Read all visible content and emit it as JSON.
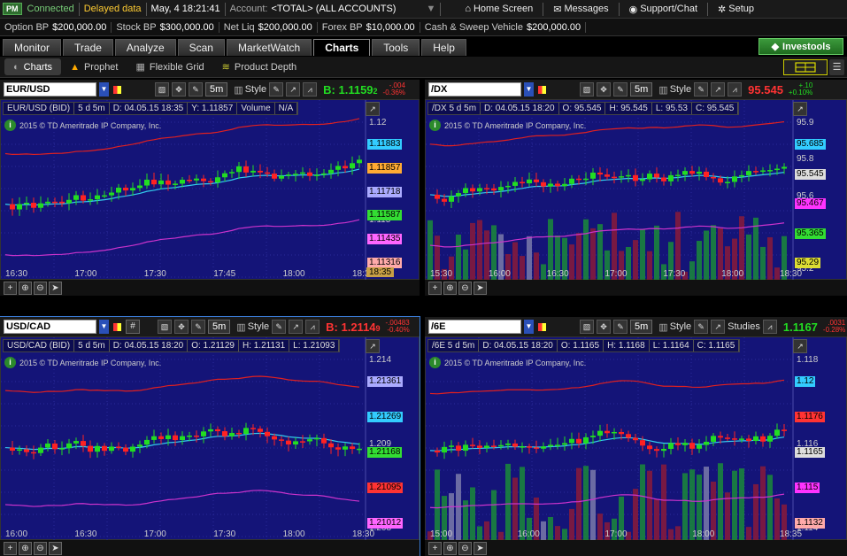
{
  "topbar": {
    "badge": "PM",
    "status": "Connected",
    "data_mode": "Delayed data",
    "datetime": "May, 4  18:21:41",
    "account_label": "Account:",
    "account_value": "<TOTAL> (ALL ACCOUNTS)",
    "home": "Home Screen",
    "messages": "Messages",
    "support": "Support/Chat",
    "setup": "Setup"
  },
  "infobar": [
    {
      "label": "Option BP",
      "value": "$200,000.00"
    },
    {
      "label": "Stock BP",
      "value": "$300,000.00"
    },
    {
      "label": "Net Liq",
      "value": "$200,000.00"
    },
    {
      "label": "Forex BP",
      "value": "$10,000.00"
    },
    {
      "label": "Cash & Sweep Vehicle",
      "value": "$200,000.00"
    }
  ],
  "tabs": [
    "Monitor",
    "Trade",
    "Analyze",
    "Scan",
    "MarketWatch",
    "Charts",
    "Tools",
    "Help"
  ],
  "active_tab": "Charts",
  "investools": "Investools",
  "subtabs": [
    "Charts",
    "Prophet",
    "Flexible Grid",
    "Product Depth"
  ],
  "copyright": "2015 © TD Ameritrade IP Company, Inc.",
  "panels": [
    {
      "symbol": "EUR/USD",
      "tf": "5m",
      "style": "Style",
      "studies": "",
      "quote": "B: 1.1159",
      "quote_sub": "2",
      "quote_color": "#22dd22",
      "chg1": "-.004",
      "chg2": "-0.36%",
      "chg_color": "#ff3333",
      "info": [
        "EUR/USD (BID)",
        "5 d 5m",
        "D: 04.05.15 18:35",
        "Y: 1.11857",
        "Volume",
        "N/A"
      ],
      "yticks": [
        "1.12",
        "1.118",
        "1.115",
        "1.114"
      ],
      "tags": [
        {
          "t": "1.11883",
          "c": "#33ccff"
        },
        {
          "t": "1.11857",
          "c": "#ffaa33"
        },
        {
          "t": "1.11718",
          "c": "#aaaaff"
        },
        {
          "t": "1.11587",
          "c": "#33dd33"
        },
        {
          "t": "1.11435",
          "c": "#ff66ff"
        },
        {
          "t": "1.11316",
          "c": "#ffaaaa"
        }
      ],
      "xticks": [
        "16:30",
        "17:00",
        "17:30",
        "17:45",
        "18:00",
        "18:30"
      ],
      "xtag": "18:35"
    },
    {
      "symbol": "/DX",
      "tf": "5m",
      "style": "Style",
      "studies": "",
      "quote": "95.545",
      "quote_sub": "",
      "quote_color": "#ff3333",
      "chg1": "+.10",
      "chg2": "+0.10%",
      "chg_color": "#22dd22",
      "info": [
        "/DX 5 d 5m",
        "D: 04.05.15 18:20",
        "O: 95.545",
        "H: 95.545",
        "L: 95.53",
        "C: 95.545"
      ],
      "yticks": [
        "95.9",
        "95.8",
        "95.6",
        "95.4",
        "95.2"
      ],
      "tags": [
        {
          "t": "95.685",
          "c": "#33ccff"
        },
        {
          "t": "95.545",
          "c": "#dddddd"
        },
        {
          "t": "95.467",
          "c": "#ff33ff"
        },
        {
          "t": "95.365",
          "c": "#33dd33"
        },
        {
          "t": "95.29",
          "c": "#dddd33"
        }
      ],
      "xticks": [
        "15:30",
        "16:00",
        "16:30",
        "17:00",
        "17:30",
        "18:00",
        "18:30"
      ],
      "xtag": ""
    },
    {
      "symbol": "USD/CAD",
      "tf": "5m",
      "style": "Style",
      "studies": "",
      "quote": "B: 1.2114",
      "quote_sub": "9",
      "quote_color": "#ff3333",
      "chg1": "-.00483",
      "chg2": "-0.40%",
      "chg_color": "#ff3333",
      "info": [
        "USD/CAD (BID)",
        "5 d 5m",
        "D: 04.05.15 18:20",
        "O: 1.21129",
        "H: 1.21131",
        "L: 1.21093"
      ],
      "yticks": [
        "1.214",
        "1.209",
        "1.208"
      ],
      "tags": [
        {
          "t": "1.21361",
          "c": "#aaaaff"
        },
        {
          "t": "1.21269",
          "c": "#33ccff"
        },
        {
          "t": "1.21168",
          "c": "#33dd33"
        },
        {
          "t": "1.21095",
          "c": "#ff3333"
        },
        {
          "t": "1.21012",
          "c": "#ff66ff"
        }
      ],
      "xticks": [
        "16:00",
        "16:30",
        "17:00",
        "17:30",
        "18:00",
        "18:30"
      ],
      "xtag": ""
    },
    {
      "symbol": "/6E",
      "tf": "5m",
      "style": "Style",
      "studies": "Studies",
      "quote": "1.1167",
      "quote_sub": "",
      "quote_color": "#22dd22",
      "chg1": ".0031",
      "chg2": "-0.28%",
      "chg_color": "#ff3333",
      "info": [
        "/6E 5 d 5m",
        "D: 04.05.15 18:20",
        "O: 1.1165",
        "H: 1.1168",
        "L: 1.1164",
        "C: 1.1165"
      ],
      "yticks": [
        "1.118",
        "1.116",
        "1.114"
      ],
      "tags": [
        {
          "t": "1.12",
          "c": "#33ccff"
        },
        {
          "t": "1.1176",
          "c": "#ff3333"
        },
        {
          "t": "1.1165",
          "c": "#dddddd"
        },
        {
          "t": "1.115",
          "c": "#ff33ff"
        },
        {
          "t": "1.1132",
          "c": "#ffaaaa"
        }
      ],
      "xticks": [
        "15:00",
        "16:00",
        "17:00",
        "18:00",
        "18:35"
      ],
      "xtag": ""
    }
  ]
}
